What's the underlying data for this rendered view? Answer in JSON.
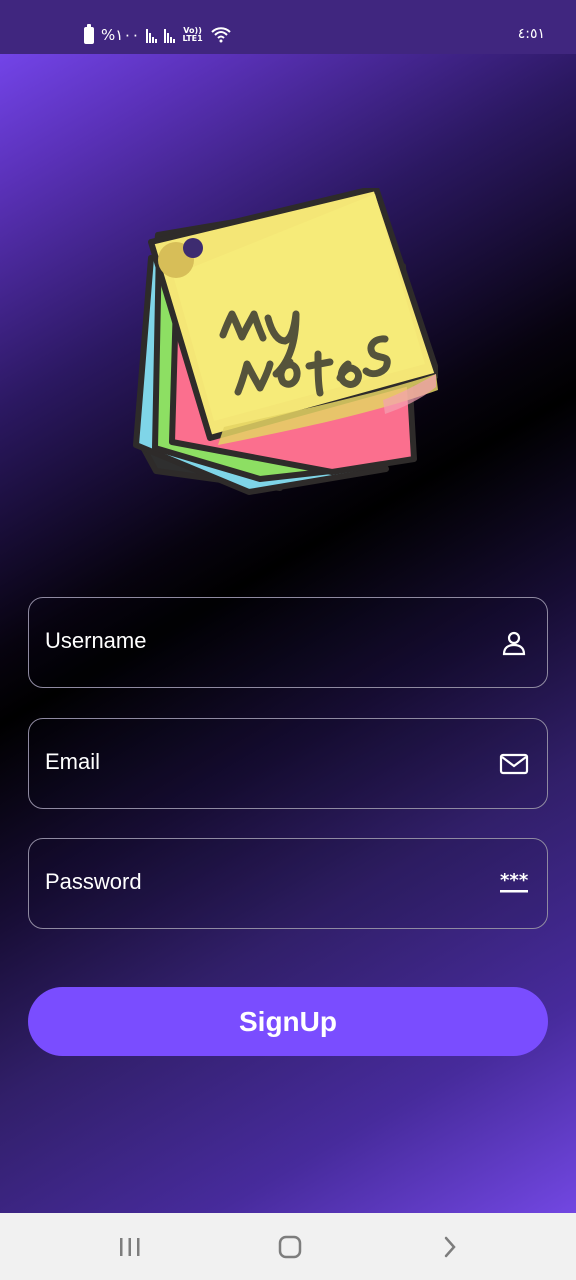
{
  "status_bar": {
    "battery_percent": "%١٠٠",
    "network_label_top": "Vo))",
    "network_label_bottom": "LTE1",
    "time": "٤:٥١"
  },
  "form": {
    "username_label": "Username",
    "email_label": "Email",
    "password_label": "Password",
    "signup_label": "SignUp"
  },
  "icons": {
    "username": "person-icon",
    "email": "mail-icon",
    "password": "password-dots-icon",
    "recent": "recent-apps-icon",
    "home": "home-icon",
    "back": "back-icon"
  },
  "colors": {
    "button": "#7a4dff",
    "note_yellow": "#f3e776",
    "note_pink": "#fa6f8c",
    "note_green": "#8ddf63",
    "note_blue": "#7ad8e6"
  }
}
